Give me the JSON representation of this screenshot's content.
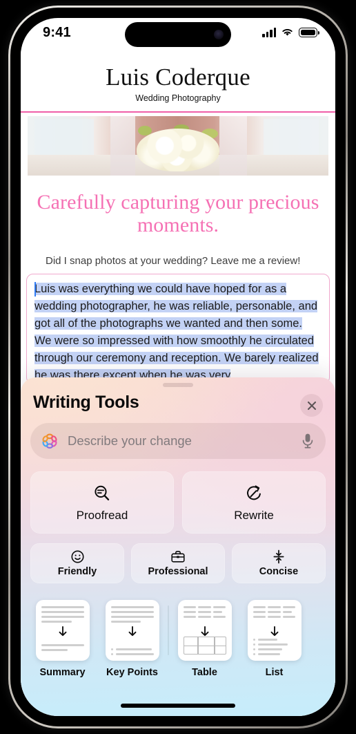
{
  "status_bar": {
    "time": "9:41",
    "cellular_icon": "signal-bars-icon",
    "wifi_icon": "wifi-icon",
    "battery_icon": "battery-icon"
  },
  "website": {
    "title": "Luis Coderque",
    "subtitle": "Wedding Photography",
    "hero_image_alt": "bride-holding-bouquet-photo",
    "tagline": "Carefully capturing your precious moments.",
    "prompt": "Did I snap photos at your wedding? Leave me a review!",
    "review_text": "Luis was everything we could have hoped for as a wedding photographer, he was reliable, personable, and got all of the photographs we wanted and then some. We were so impressed with how smoothly he circulated through our ceremony and reception. We barely realized he was there except when he was very",
    "accent_pink": "#ef5fa8",
    "tagline_color": "#f571b4",
    "selection_color": "#c3d2f5"
  },
  "writing_tools": {
    "title": "Writing Tools",
    "close_label": "×",
    "close_icon": "close-icon",
    "grabber_icon": "sheet-grabber",
    "describe_field": {
      "placeholder": "Describe your change",
      "value": "",
      "leading_icon": "apple-intelligence-icon",
      "trailing_icon": "microphone-icon"
    },
    "primary_actions": [
      {
        "label": "Proofread",
        "icon": "proofread-magnifier-icon"
      },
      {
        "label": "Rewrite",
        "icon": "rewrite-circular-arrow-icon"
      }
    ],
    "tone_actions": [
      {
        "label": "Friendly",
        "icon": "smiley-face-icon"
      },
      {
        "label": "Professional",
        "icon": "briefcase-icon"
      },
      {
        "label": "Concise",
        "icon": "compress-arrows-icon"
      }
    ],
    "format_actions": [
      {
        "label": "Summary",
        "icon": "summary-document-icon"
      },
      {
        "label": "Key Points",
        "icon": "key-points-document-icon"
      },
      {
        "label": "Table",
        "icon": "table-document-icon"
      },
      {
        "label": "List",
        "icon": "list-document-icon"
      }
    ]
  },
  "home_indicator": "home-indicator"
}
